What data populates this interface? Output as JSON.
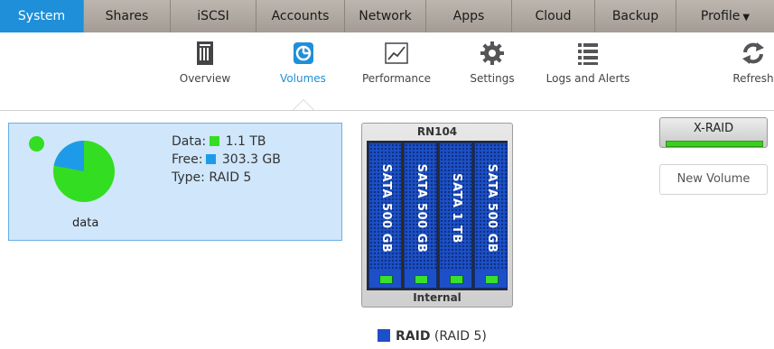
{
  "topnav": {
    "tabs": [
      {
        "label": "System",
        "active": true
      },
      {
        "label": "Shares"
      },
      {
        "label": "iSCSI"
      },
      {
        "label": "Accounts"
      },
      {
        "label": "Network"
      },
      {
        "label": "Apps"
      },
      {
        "label": "Cloud"
      },
      {
        "label": "Backup"
      },
      {
        "label": "Profile"
      }
    ]
  },
  "toolbar": {
    "items": [
      {
        "label": "Overview",
        "icon": "overview-icon"
      },
      {
        "label": "Volumes",
        "icon": "volumes-icon",
        "active": true
      },
      {
        "label": "Performance",
        "icon": "performance-icon"
      },
      {
        "label": "Settings",
        "icon": "gear-icon"
      },
      {
        "label": "Logs and Alerts",
        "icon": "list-icon"
      },
      {
        "label": "Refresh",
        "icon": "refresh-icon"
      }
    ]
  },
  "volume": {
    "name": "data",
    "status": "healthy",
    "data_label": "Data:",
    "data_value": "1.1 TB",
    "free_label": "Free:",
    "free_value": "303.3 GB",
    "type_label": "Type:",
    "type_value": "RAID 5",
    "used_fraction": 0.78
  },
  "device": {
    "model": "RN104",
    "location": "Internal",
    "drives": [
      {
        "label": "SATA 500 GB"
      },
      {
        "label": "SATA 500 GB"
      },
      {
        "label": "SATA 1 TB"
      },
      {
        "label": "SATA 500 GB"
      }
    ]
  },
  "controls": {
    "xraid_label": "X-RAID",
    "new_volume_label": "New Volume"
  },
  "raid_legend": {
    "name": "RAID",
    "detail": "(RAID 5)"
  },
  "colors": {
    "accent": "#1e8fd8",
    "data": "#33dd22",
    "free": "#1e9be8",
    "drive": "#1d50c8"
  }
}
